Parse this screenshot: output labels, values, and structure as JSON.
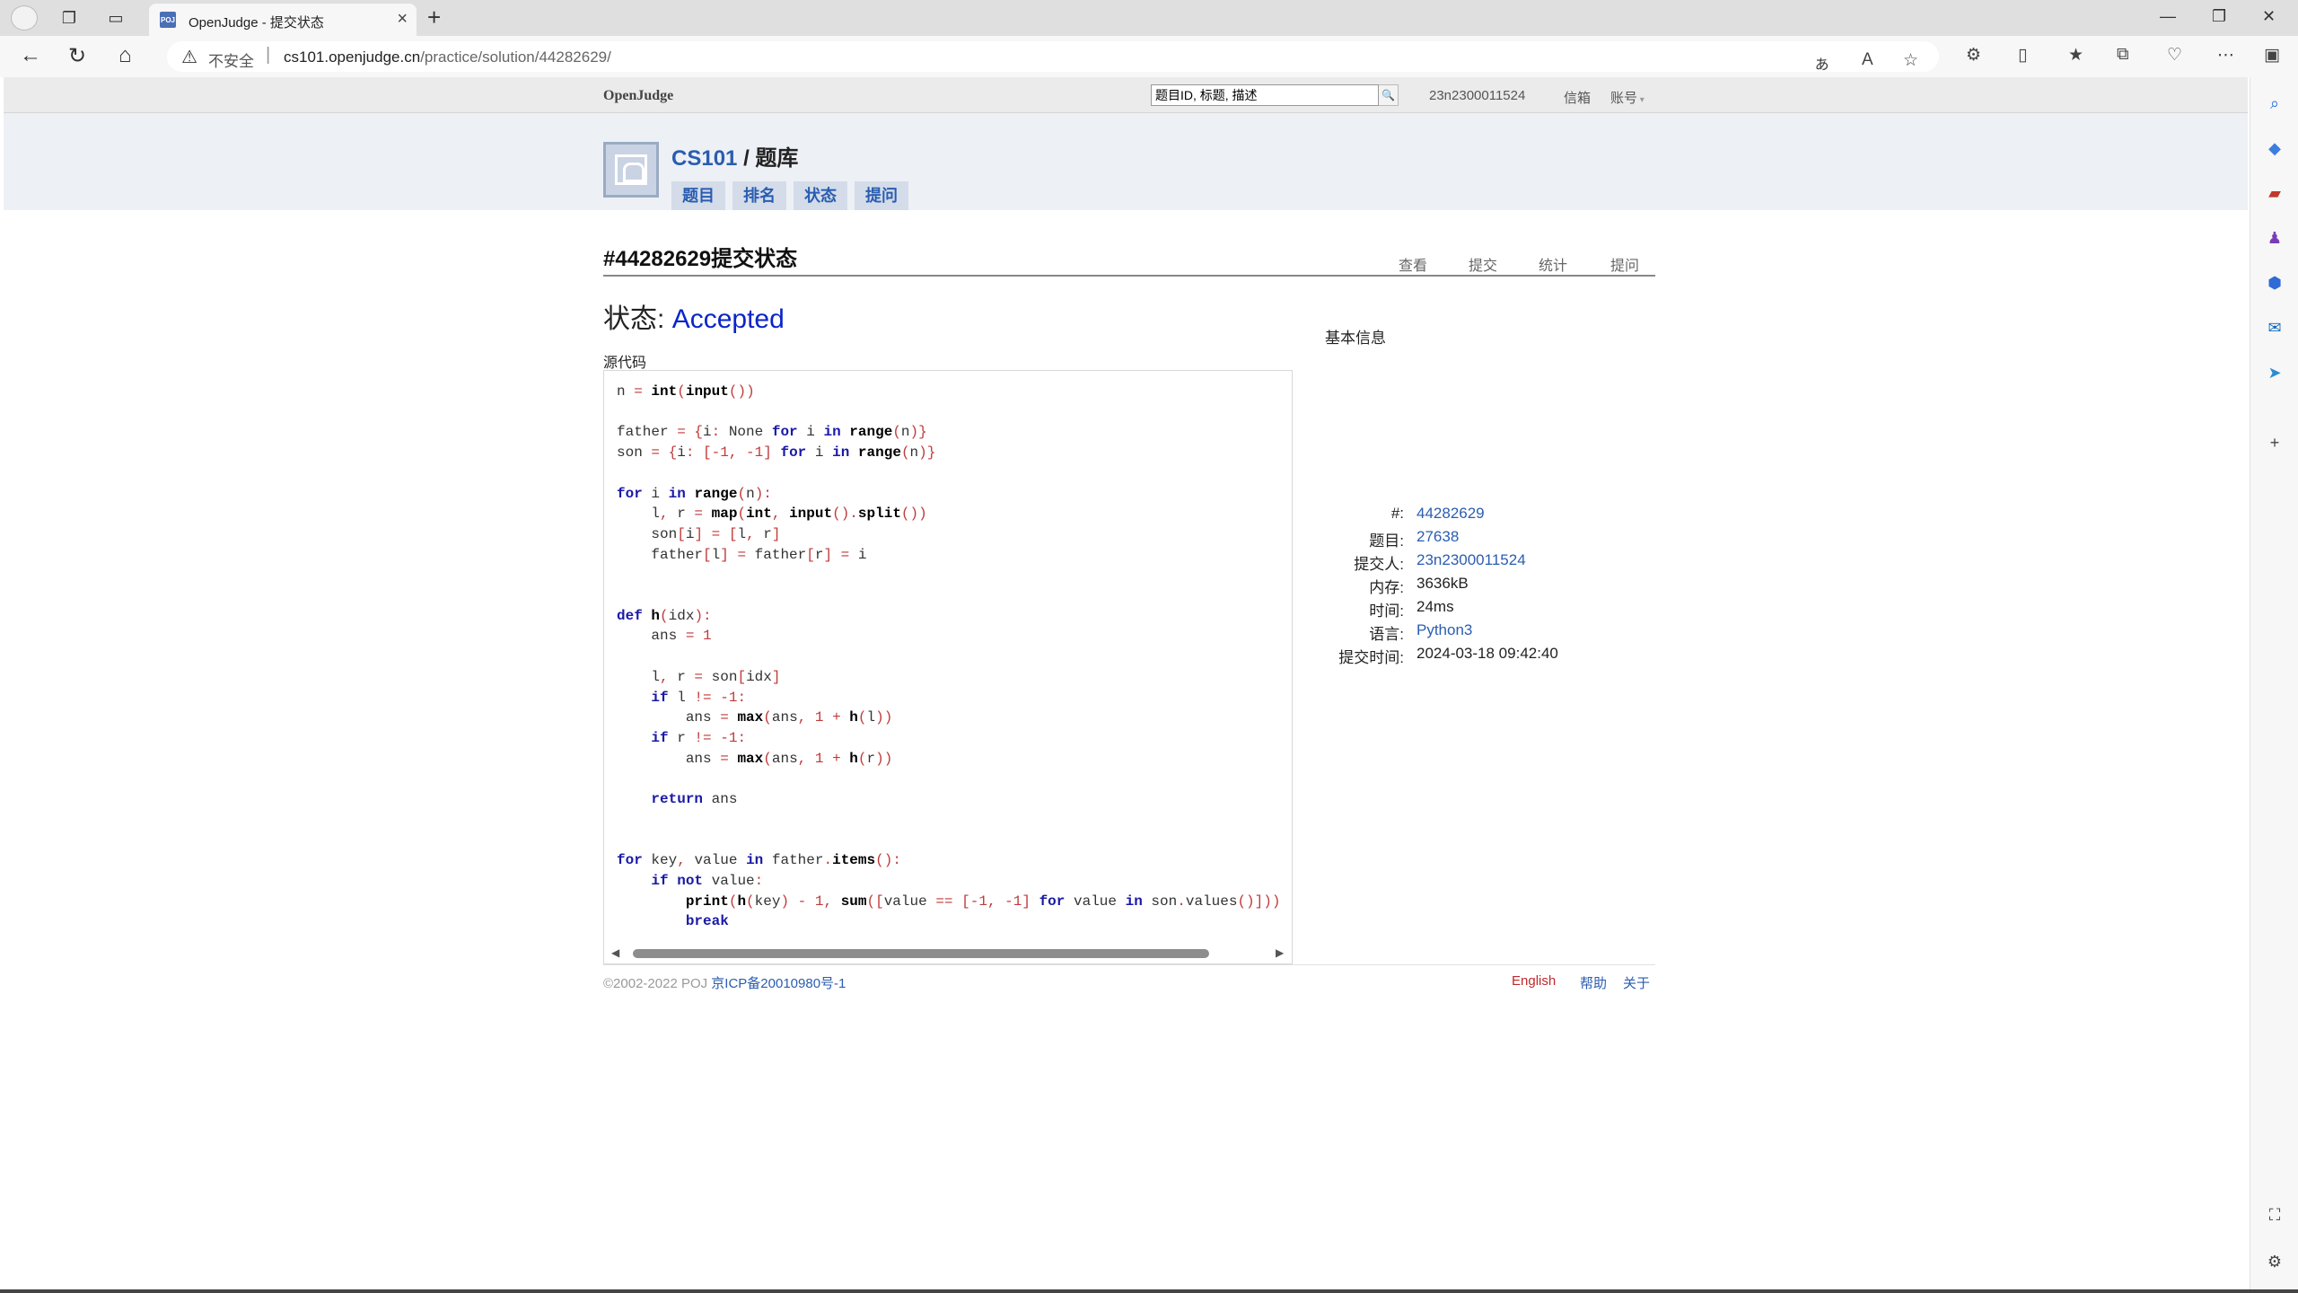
{
  "browser": {
    "tab_title": "OpenJudge - 提交状态",
    "tab_favicon": "POJ",
    "insecure_label": "不安全",
    "url_host": "cs101.openjudge.cn",
    "url_path": "/practice/solution/44282629/"
  },
  "topnav": {
    "brand": "OpenJudge",
    "search_placeholder": "题目ID, 标题, 描述",
    "user": "23n2300011524",
    "mail": "信箱",
    "account": "账号"
  },
  "header": {
    "course": "CS101",
    "separator": "/",
    "section": "题库",
    "tabs": [
      "题目",
      "排名",
      "状态",
      "提问"
    ]
  },
  "content": {
    "title": "#44282629提交状态",
    "actions": [
      "查看",
      "提交",
      "统计",
      "提问"
    ],
    "status_label": "状态:",
    "status_value": "Accepted",
    "code_label": "源代码"
  },
  "info": {
    "title": "基本信息",
    "rows": [
      {
        "label": "#:",
        "value": "44282629",
        "link": true
      },
      {
        "label": "题目:",
        "value": "27638",
        "link": true
      },
      {
        "label": "提交人:",
        "value": "23n2300011524",
        "link": true
      },
      {
        "label": "内存:",
        "value": "3636kB",
        "link": false
      },
      {
        "label": "时间:",
        "value": "24ms",
        "link": false
      },
      {
        "label": "语言:",
        "value": "Python3",
        "link": true
      },
      {
        "label": "提交时间:",
        "value": "2024-03-18 09:42:40",
        "link": false
      }
    ]
  },
  "code_lines": [
    "n = int(input())",
    "",
    "father = {i: None for i in range(n)}",
    "son = {i: [-1, -1] for i in range(n)}",
    "",
    "for i in range(n):",
    "    l, r = map(int, input().split())",
    "    son[i] = [l, r]",
    "    father[l] = father[r] = i",
    "",
    "",
    "def h(idx):",
    "    ans = 1",
    "",
    "    l, r = son[idx]",
    "    if l != -1:",
    "        ans = max(ans, 1 + h(l))",
    "    if r != -1:",
    "        ans = max(ans, 1 + h(r))",
    "",
    "    return ans",
    "",
    "",
    "for key, value in father.items():",
    "    if not value:",
    "        print(h(key) - 1, sum([value == [-1, -1] for value in son.values()]))",
    "        break"
  ],
  "footer": {
    "copyright": "©2002-2022 POJ ",
    "icp": "京ICP备20010980号-1",
    "english": "English",
    "help": "帮助",
    "about": "关于"
  },
  "icons": {
    "back": "back-arrow-icon",
    "refresh": "refresh-icon",
    "home": "home-icon",
    "search": "search-icon"
  }
}
